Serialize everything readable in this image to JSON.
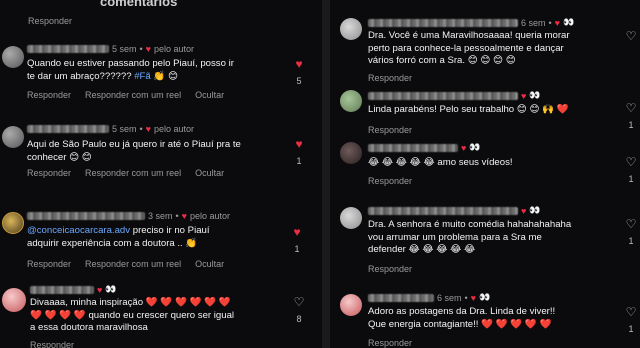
{
  "left": {
    "top_partial": {
      "title": "comentarios",
      "reply": "Responder"
    },
    "comments": [
      {
        "time": "5 sem",
        "by_author": "pelo autor",
        "text_a": "Quando eu estiver passando pelo Piauí, posso ir",
        "text_b": "te dar um abraço?????? ",
        "hashtag": "#Fã",
        "emoji_tail": " 👏 😊",
        "reply": "Responder",
        "reel": "Responder com um reel",
        "hide": "Ocultar",
        "likes": "5"
      },
      {
        "time": "5 sem",
        "by_author": "pelo autor",
        "text_a": "Aqui de São Paulo eu já quero ir até o Piauí pra te",
        "text_b": "conhecer 😊 😊",
        "reply": "Responder",
        "reel": "Responder com um reel",
        "hide": "Ocultar",
        "likes": "1"
      },
      {
        "time": "3 sem",
        "by_author": "pelo autor",
        "handle": "@conceicaocarcara.adv",
        "text_a": " preciso ir no Piauí",
        "text_b": "adquirir experiência com a doutora .. 👏",
        "reply": "Responder",
        "reel": "Responder com um reel",
        "hide": "Ocultar",
        "likes": "1"
      },
      {
        "text_a": "Divaaaa, minha inspiração ❤️ ❤️ ❤️ ❤️ ❤️ ❤️",
        "text_b": "❤️ ❤️ ❤️ ❤️  quando eu crescer quero ser igual",
        "text_c": "a essa doutora maravilhosa",
        "reply": "Responder",
        "likes": "8"
      }
    ]
  },
  "right": {
    "comments": [
      {
        "time": "6 sem",
        "text_a": "Dra. Você é uma Maravilhosaaaa! queria morar",
        "text_b": "perto para conhece-la pessoalmente e dançar",
        "text_c": "vários forró com a Sra. 😊 😊 😊 😊",
        "reply": "Responder"
      },
      {
        "text_a": "Linda parabéns! Pelo seu trabalho 😊 😊 🙌 ❤️",
        "reply": "Responder",
        "likes": "1"
      },
      {
        "text_a": "😂 😂 😂 😂 😂  amo seus vídeos!",
        "reply": "Responder",
        "likes": "1"
      },
      {
        "text_a": "Dra. A senhora é muito comédia hahahahahaha",
        "text_b": "vou arrumar um problema para a Sra me",
        "text_c": "defender 😂 😂 😂 😂 😂",
        "reply": "Responder",
        "likes": "1"
      },
      {
        "time": "6 sem",
        "text_a": "Adoro as postagens da Dra. Linda de viver!!",
        "text_b": "Que energia contagiante!! ❤️ ❤️ ❤️ ❤️ ❤️",
        "reply": "Responder",
        "likes": "1"
      }
    ]
  }
}
